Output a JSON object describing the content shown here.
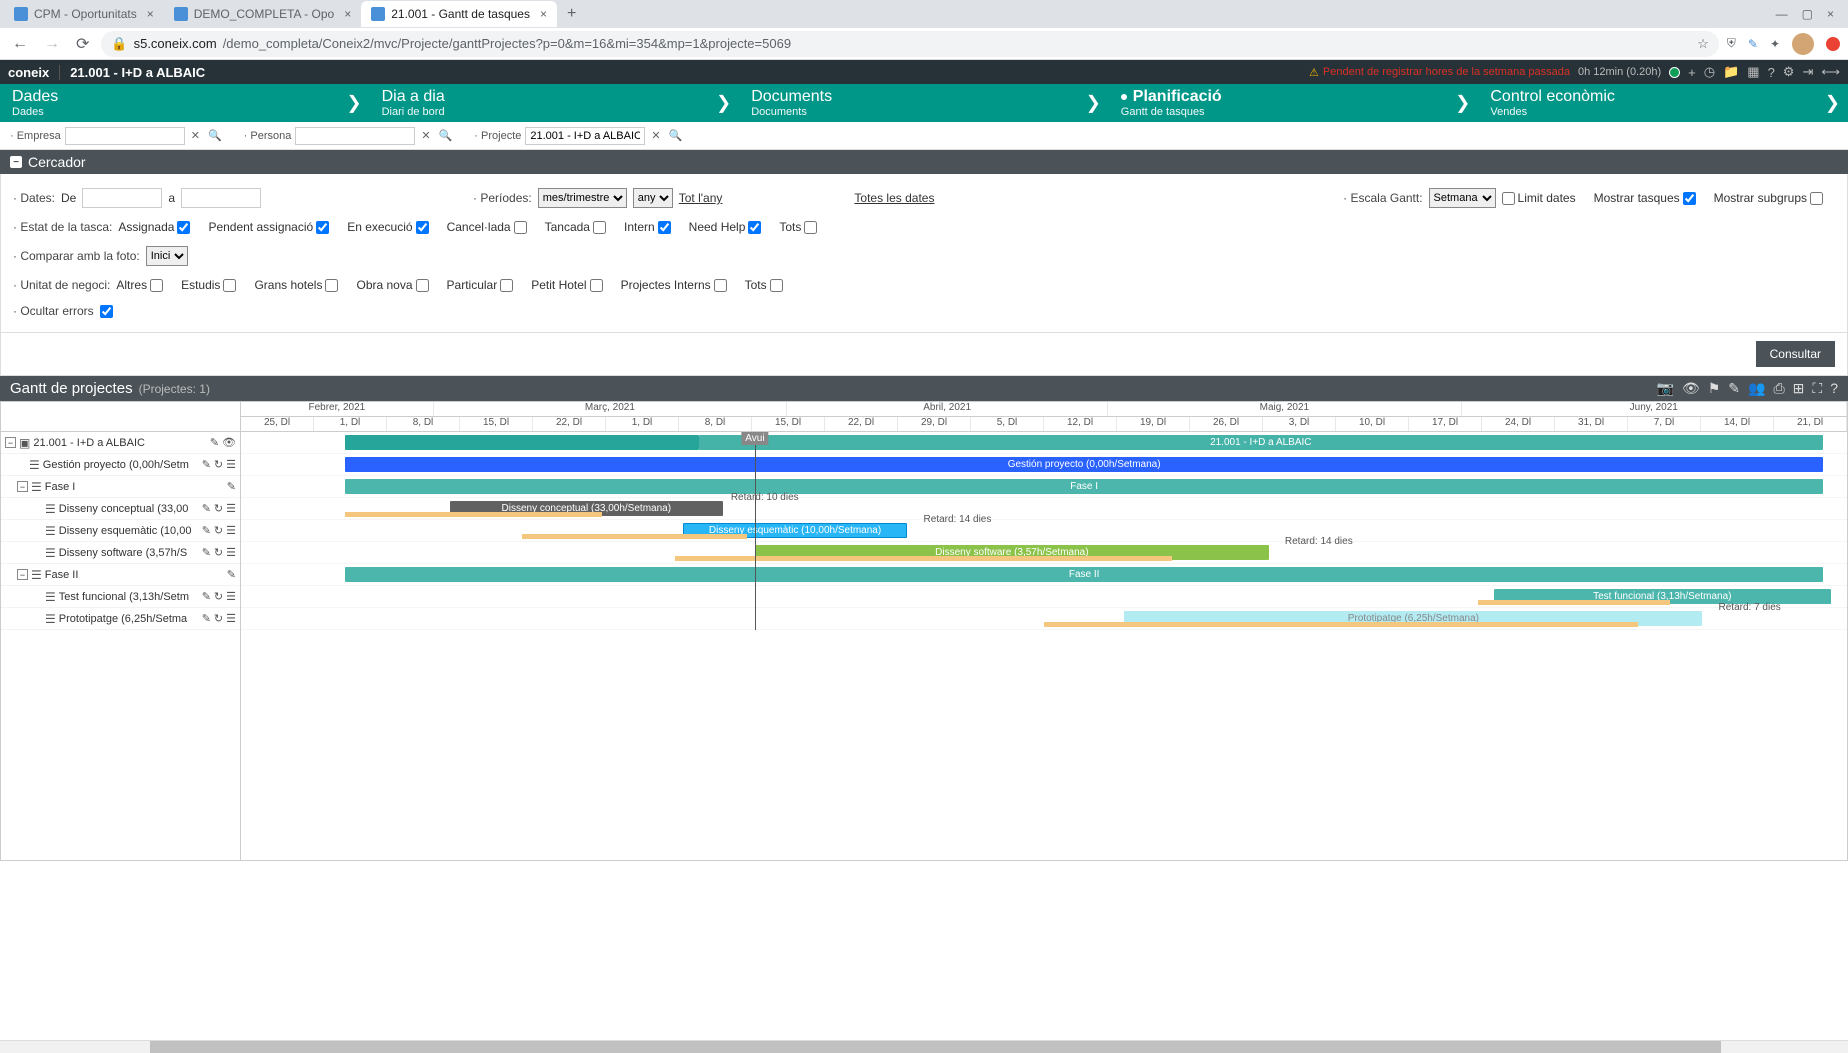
{
  "browser": {
    "tabs": [
      {
        "title": "CPM - Oportunitats",
        "active": false
      },
      {
        "title": "DEMO_COMPLETA - Opo",
        "active": false
      },
      {
        "title": "21.001 - Gantt de tasques",
        "active": true
      }
    ],
    "url_domain": "s5.coneix.com",
    "url_path": "/demo_completa/Coneix2/mvc/Projecte/ganttProjectes?p=0&m=16&mi=354&mp=1&projecte=5069"
  },
  "header": {
    "brand": "coneix",
    "title": "21.001 - I+D a ALBAIC",
    "warning": "Pendent de registrar hores de la setmana passada",
    "time": "0h 12min (0.20h)"
  },
  "nav": [
    {
      "title": "Dades",
      "sub": "Dades"
    },
    {
      "title": "Dia a dia",
      "sub": "Diari de bord"
    },
    {
      "title": "Documents",
      "sub": "Documents"
    },
    {
      "title": "Planificació",
      "sub": "Gantt de tasques",
      "active": true
    },
    {
      "title": "Control econòmic",
      "sub": "Vendes"
    }
  ],
  "filters": {
    "empresa_label": "· Empresa",
    "persona_label": "· Persona",
    "projecte_label": "· Projecte",
    "projecte_value": "21.001 - I+D a ALBAIC"
  },
  "cercador": {
    "title": "Cercador",
    "dates_label": "· Dates:",
    "de": "De",
    "a": "a",
    "periodes_label": "· Períodes:",
    "periode_sel": "mes/trimestre",
    "any_sel": "any",
    "tot_lany": "Tot l'any",
    "totes_dates": "Totes les dates",
    "escala_label": "· Escala Gantt:",
    "escala_sel": "Setmana",
    "limit_dates": "Limit dates",
    "mostrar_tasques": "Mostrar tasques",
    "mostrar_subgrups": "Mostrar subgrups",
    "estat_label": "· Estat de la tasca:",
    "estats": {
      "assignada": "Assignada",
      "pendent": "Pendent assignació",
      "execucio": "En execució",
      "cancelada": "Cancel·lada",
      "tancada": "Tancada",
      "intern": "Intern",
      "needhelp": "Need Help",
      "tots": "Tots"
    },
    "comparar_label": "· Comparar amb la foto:",
    "comparar_sel": "Inici",
    "unitat_label": "· Unitat de negoci:",
    "unitats": {
      "altres": "Altres",
      "estudis": "Estudis",
      "granshotels": "Grans hotels",
      "obranova": "Obra nova",
      "particular": "Particular",
      "petithotel": "Petit Hotel",
      "projectesinterns": "Projectes Interns",
      "tots": "Tots"
    },
    "ocultar_errors": "· Ocultar errors",
    "consultar": "Consultar"
  },
  "gantt_header": {
    "title": "Gantt de projectes",
    "subtitle": "(Projectes: 1)"
  },
  "gantt": {
    "months": [
      "Febrer, 2021",
      "Març, 2021",
      "Abril, 2021",
      "Maig, 2021",
      "Juny, 2021"
    ],
    "days": [
      "25, Dl",
      "1, Dl",
      "8, Dl",
      "15, Dl",
      "22, Dl",
      "1, Dl",
      "8, Dl",
      "15, Dl",
      "22, Dl",
      "29, Dl",
      "5, Dl",
      "12, Dl",
      "19, Dl",
      "26, Dl",
      "3, Dl",
      "10, Dl",
      "17, Dl",
      "24, Dl",
      "31, Dl",
      "7, Dl",
      "14, Dl",
      "21, Dl"
    ],
    "today_label": "Avui",
    "rows": [
      {
        "label": "21.001 - I+D a ALBAIC",
        "level": 0,
        "type": "project"
      },
      {
        "label": "Gestión proyecto (0,00h/Setm",
        "level": 1,
        "type": "task"
      },
      {
        "label": "Fase I",
        "level": 1,
        "type": "phase"
      },
      {
        "label": "Disseny conceptual (33,00",
        "level": 2,
        "type": "task"
      },
      {
        "label": "Disseny esquemàtic (10,00",
        "level": 2,
        "type": "task"
      },
      {
        "label": "Disseny software (3,57h/S",
        "level": 2,
        "type": "task"
      },
      {
        "label": "Fase II",
        "level": 1,
        "type": "phase"
      },
      {
        "label": "Test funcional (3,13h/Setm",
        "level": 2,
        "type": "task"
      },
      {
        "label": "Prototipatge (6,25h/Setma",
        "level": 2,
        "type": "task"
      }
    ],
    "bars": {
      "project": "21.001 - I+D a ALBAIC",
      "gestion": "Gestión proyecto (0,00h/Setmana)",
      "fase1": "Fase I",
      "conceptual": "Disseny conceptual (33,00h/Setmana)",
      "esquematic": "Disseny esquemàtic (10,00h/Setmana)",
      "software": "Disseny software (3,57h/Setmana)",
      "fase2": "Fase II",
      "testfunc": "Test funcional (3,13h/Setmana)",
      "prototipatge": "Prototipatge (6,25h/Setmana)"
    },
    "delays": {
      "d10": "Retard: 10 dies",
      "d14a": "Retard: 14 dies",
      "d14b": "Retard: 14 dies",
      "d7": "Retard: 7 dies"
    }
  }
}
